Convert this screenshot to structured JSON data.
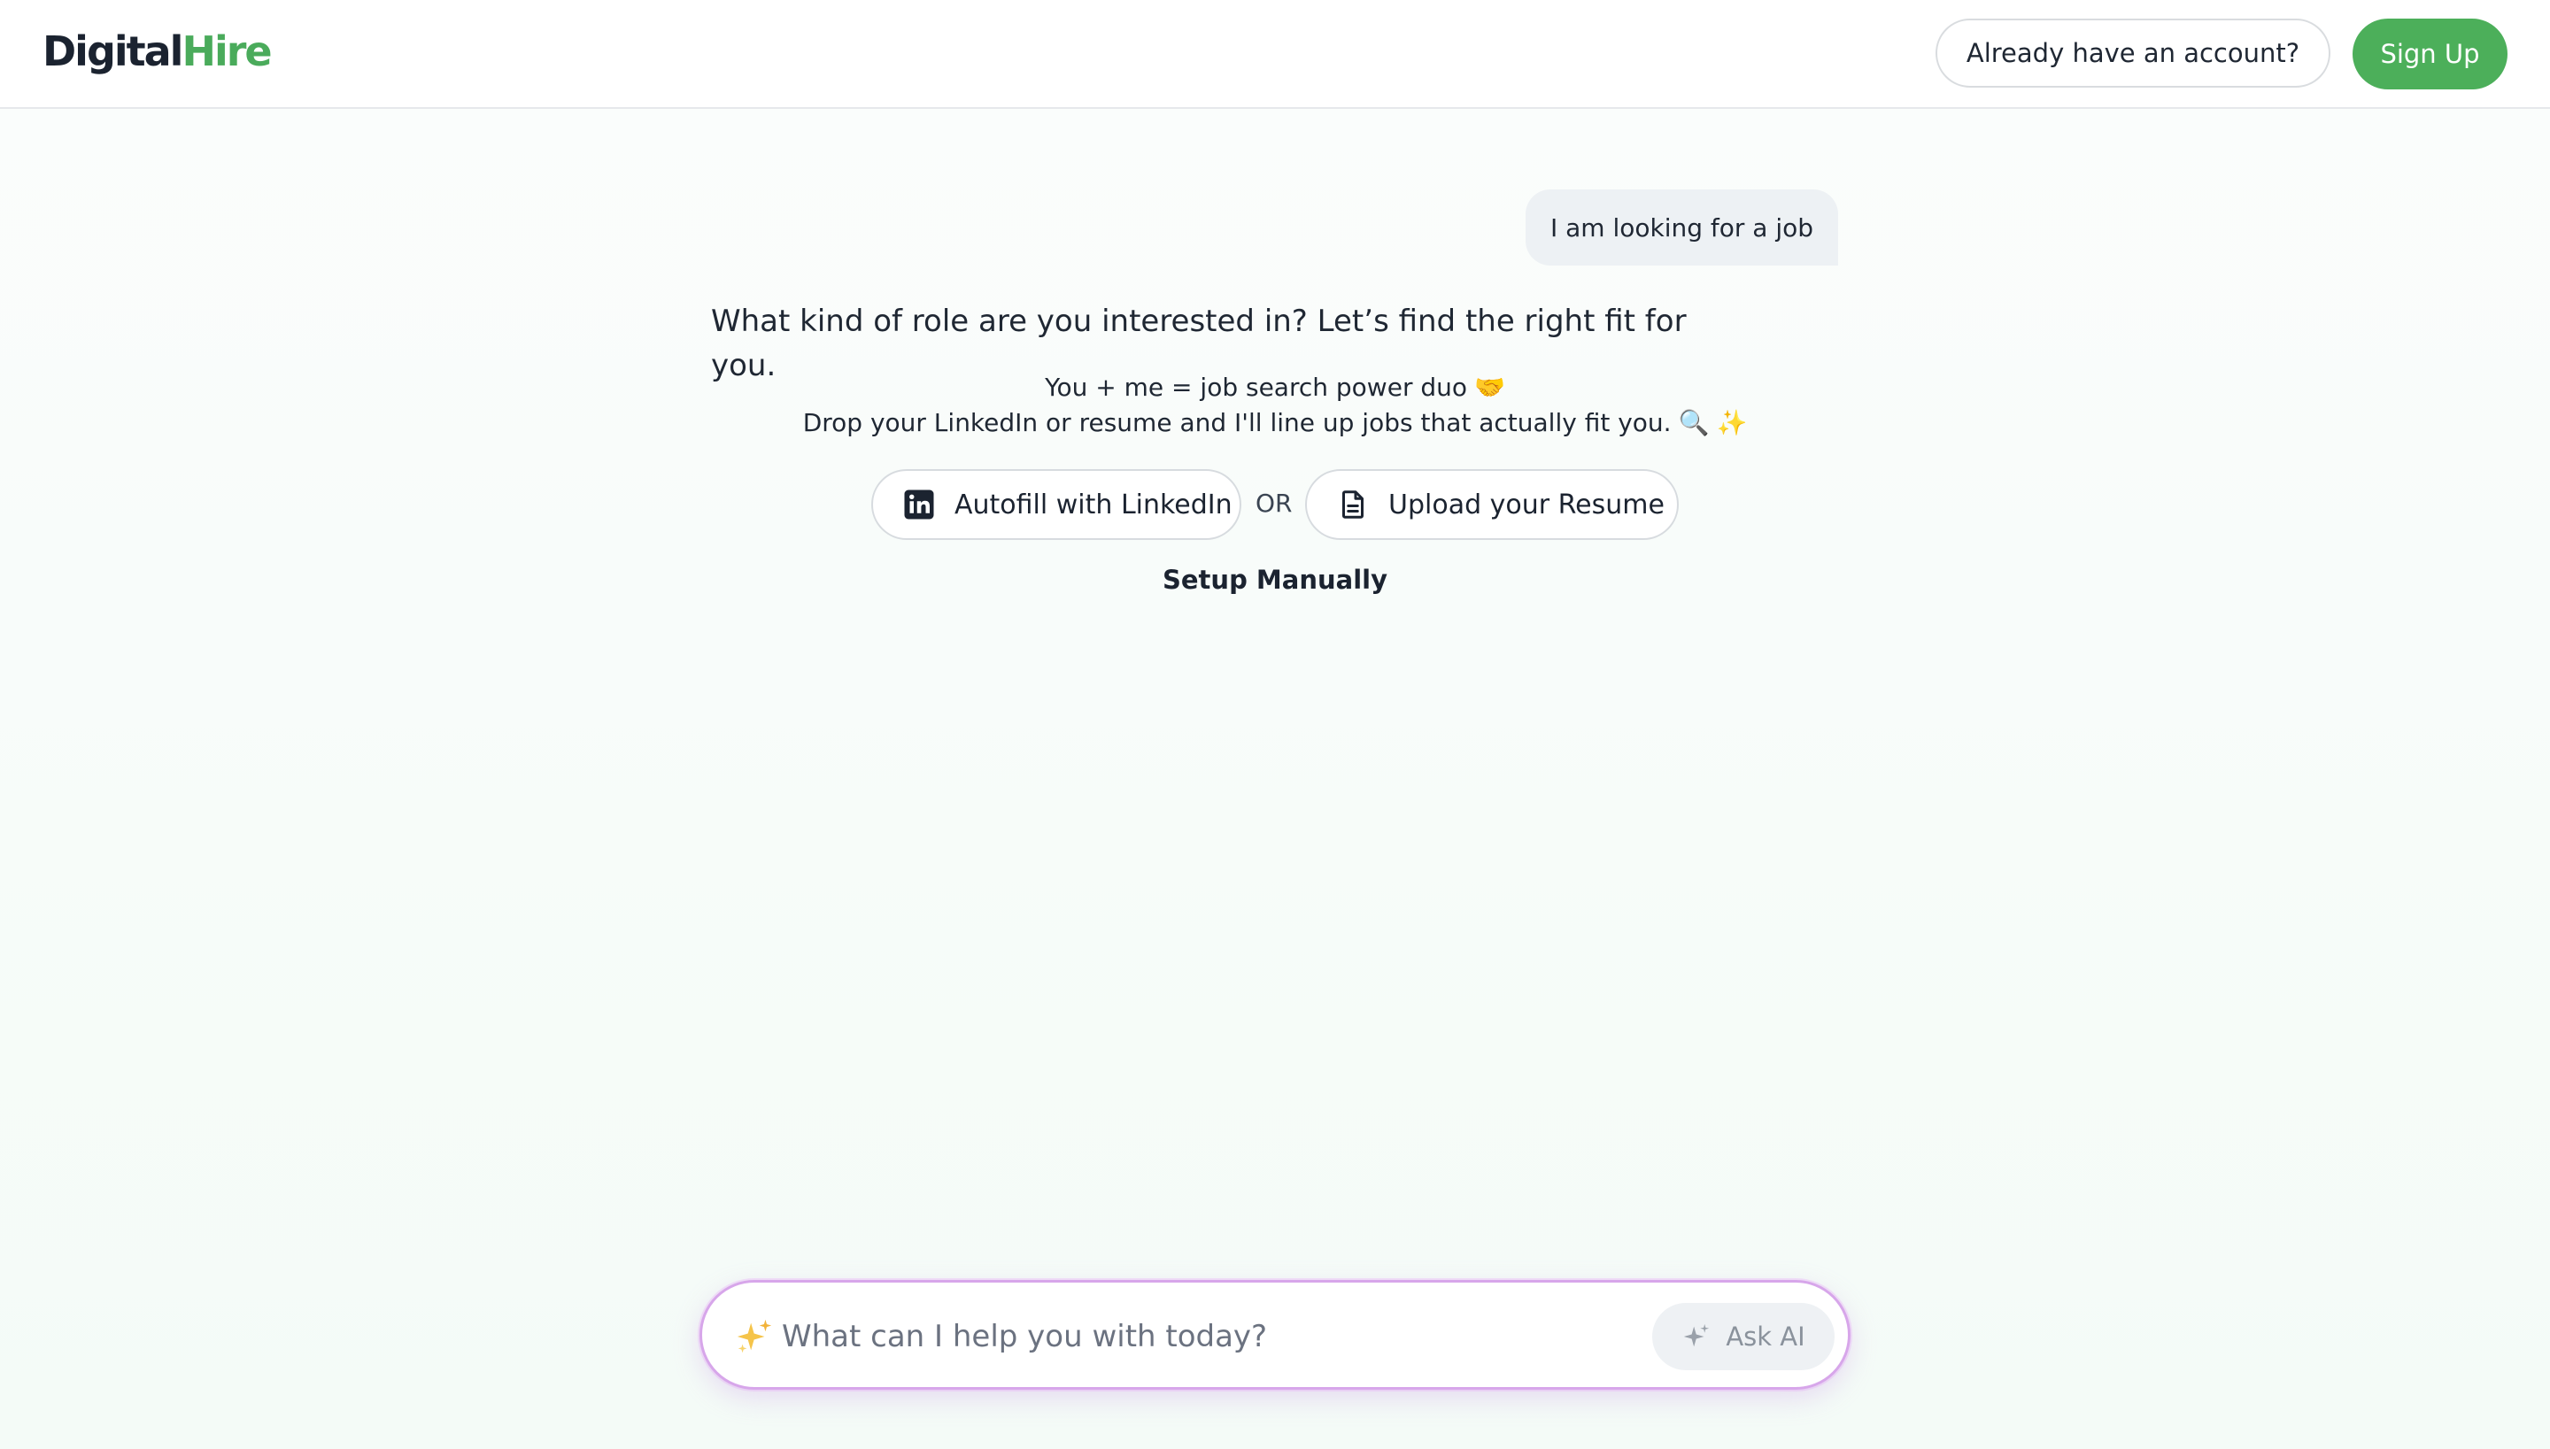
{
  "header": {
    "logo_part1": "Digital",
    "logo_part2": "Hire",
    "account_label": "Already have an account?",
    "signup_label": "Sign Up"
  },
  "chat": {
    "user_message": "I am looking for a job",
    "bot_title": "What kind of role are you interested in? Let’s find the right fit for you.",
    "bot_line1": "You + me = job search power duo",
    "bot_line2": "Drop your LinkedIn or resume and I'll line up jobs that actually fit you.",
    "emoji_handshake": "🤝",
    "emoji_search": "🔍",
    "emoji_sparkle": "✨"
  },
  "actions": {
    "linkedin_label": "Autofill with LinkedIn",
    "or_label": "OR",
    "resume_label": "Upload your Resume",
    "setup_label": "Setup Manually"
  },
  "ask": {
    "placeholder": "What can I help you with today?",
    "button_label": "Ask AI"
  },
  "colors": {
    "brand_green": "#4caf5a",
    "ask_border": "#d7a6ea"
  }
}
